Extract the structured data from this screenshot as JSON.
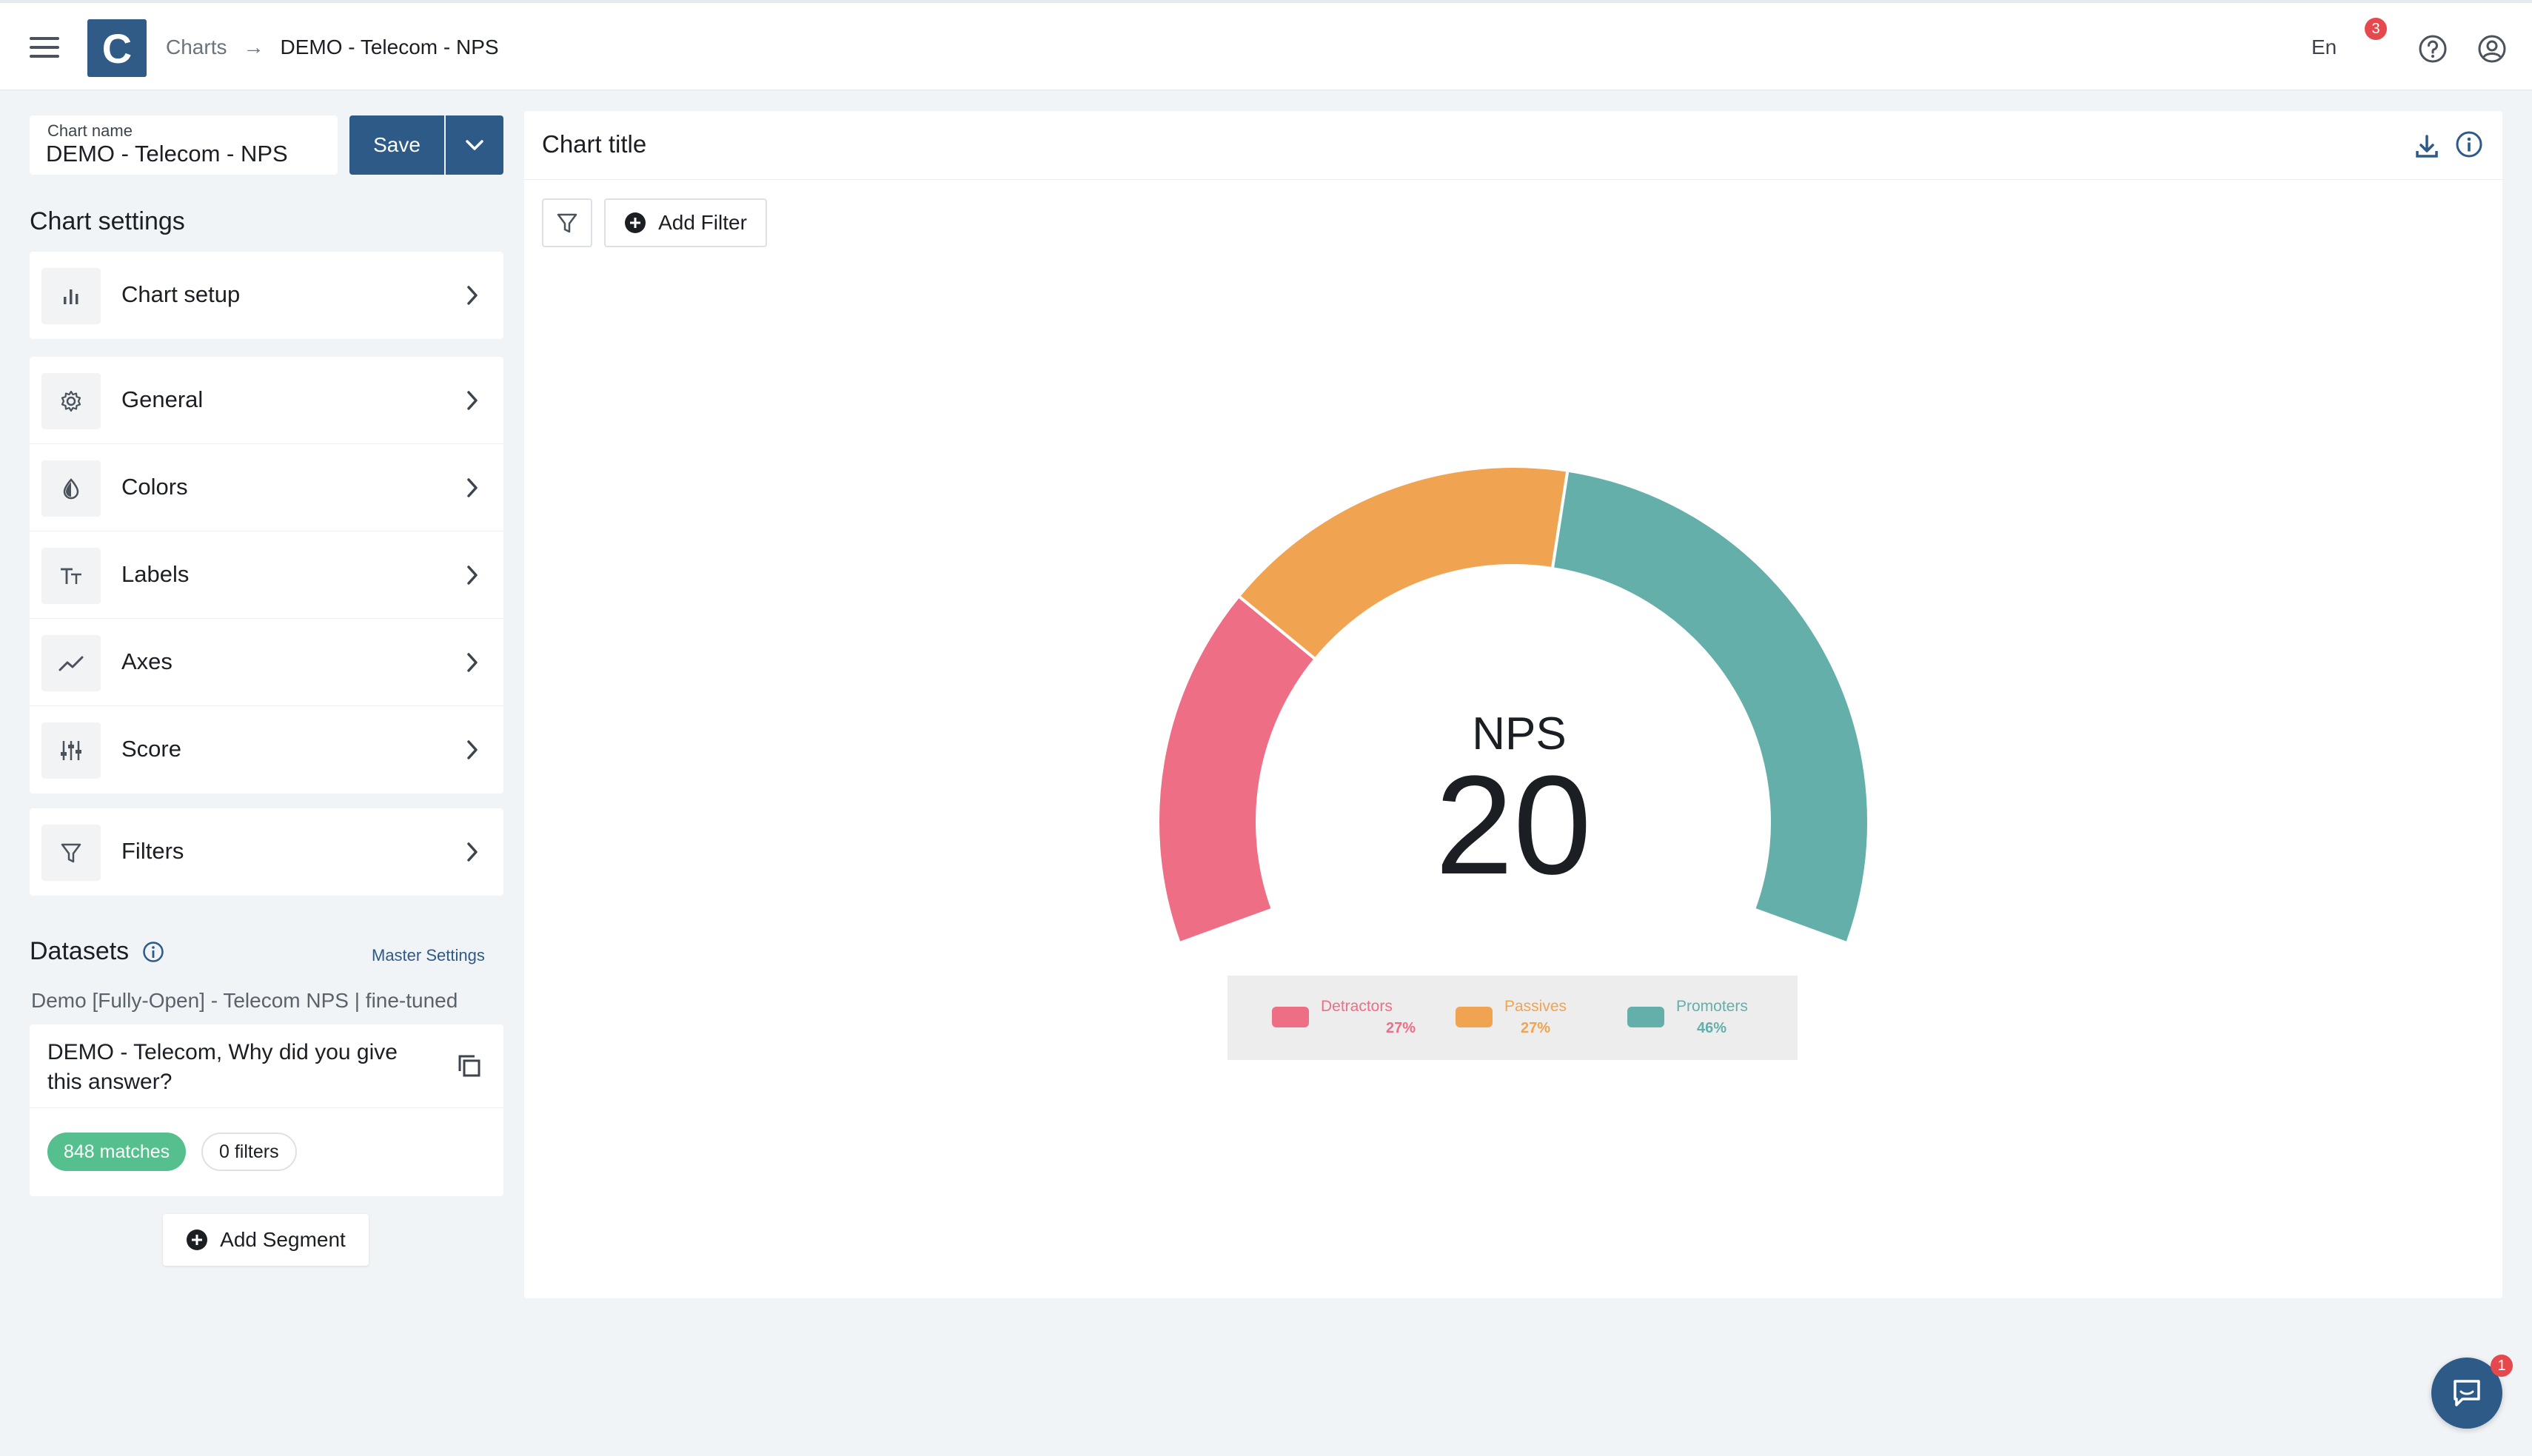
{
  "header": {
    "breadcrumb_parent": "Charts",
    "breadcrumb_current": "DEMO - Telecom - NPS",
    "logo_letter": "C",
    "language": "En",
    "notification_count": "3"
  },
  "editor": {
    "chart_name_label": "Chart name",
    "chart_name_value": "DEMO - Telecom - NPS",
    "save_label": "Save",
    "settings_title": "Chart settings",
    "setup_item": {
      "label": "Chart setup",
      "icon": "bar-chart-icon"
    },
    "settings_items": [
      {
        "label": "General",
        "icon": "gear-icon"
      },
      {
        "label": "Colors",
        "icon": "color-drop-icon"
      },
      {
        "label": "Labels",
        "icon": "text-size-icon"
      },
      {
        "label": "Axes",
        "icon": "trend-line-icon"
      },
      {
        "label": "Score",
        "icon": "sliders-icon"
      }
    ],
    "filters_item": {
      "label": "Filters",
      "icon": "filter-icon"
    }
  },
  "datasets": {
    "title": "Datasets",
    "master_settings": "Master Settings",
    "dataset_name": "Demo [Fully-Open] - Telecom NPS | fine-tuned",
    "question": "DEMO - Telecom, Why did you give this answer?",
    "matches": "848 matches",
    "filters": "0 filters",
    "add_segment": "Add Segment"
  },
  "chart_panel": {
    "title": "Chart title",
    "add_filter": "Add Filter"
  },
  "chart_data": {
    "type": "gauge",
    "center_label": "NPS",
    "center_value": "20",
    "series": [
      {
        "name": "Detractors",
        "percent_label": "27%",
        "value": 27,
        "color": "#ee6e85"
      },
      {
        "name": "Passives",
        "percent_label": "27%",
        "value": 27,
        "color": "#f0a451"
      },
      {
        "name": "Promoters",
        "percent_label": "46%",
        "value": 46,
        "color": "#64afaa"
      }
    ]
  },
  "chat": {
    "badge_count": "1"
  },
  "colors": {
    "brand": "#2d5a86",
    "matches_green": "#55c08d",
    "badge_red": "#e5484d"
  }
}
